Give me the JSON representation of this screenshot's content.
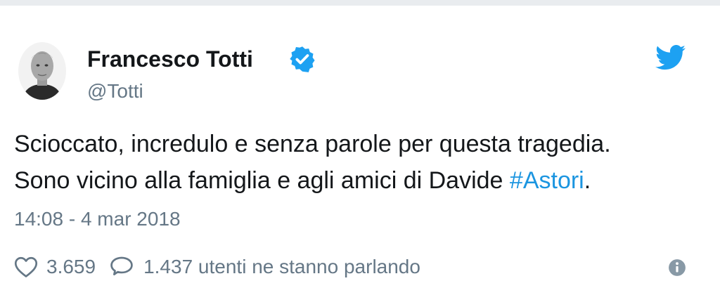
{
  "author": {
    "name": "Francesco Totti",
    "handle": "@Totti",
    "verified": true,
    "avatar_icon": "profile-photo"
  },
  "tweet": {
    "line1": "Scioccato, incredulo e senza parole per questa tragedia.",
    "line2_prefix": "Sono vicino alla famiglia e agli amici di Davide ",
    "hashtag": "#Astori",
    "line2_suffix": ".",
    "timestamp": "14:08 - 4 mar 2018"
  },
  "actions": {
    "like_count": "3.659",
    "reply_text": "1.437 utenti ne stanno parlando"
  },
  "icons": {
    "platform": "twitter-bird-icon",
    "verified": "verified-badge-icon",
    "like": "heart-icon",
    "reply": "speech-bubble-icon",
    "info": "info-icon"
  },
  "colors": {
    "brand": "#1da1f2",
    "link": "#1b95e0",
    "text": "#14171a",
    "muted": "#657786"
  }
}
